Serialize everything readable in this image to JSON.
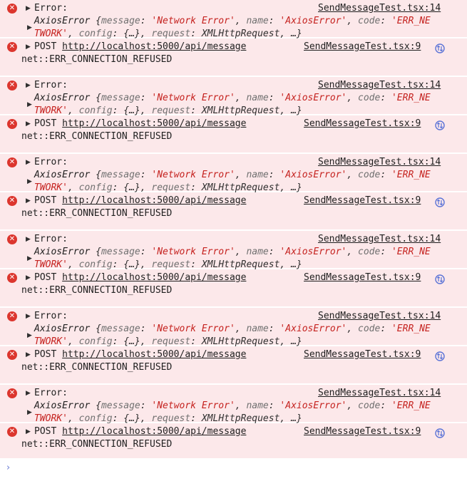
{
  "console": {
    "messages": [
      {
        "kind": "error-object",
        "label": "Error:",
        "source": "SendMessageTest.tsx:14",
        "class_name": "AxiosError",
        "brace_open": "{",
        "k1": "message",
        "v1": "'Network Error'",
        "k2": "name",
        "v2": "'AxiosError'",
        "k3": "code",
        "v3a": "'ERR_NE",
        "v3b": "TWORK'",
        "k4": "config",
        "v4": "{…}",
        "k5": "request",
        "v5": "XMLHttpRequest",
        "tail": ", …}"
      },
      {
        "kind": "network-error",
        "method": "POST",
        "url": "http://localhost:5000/api/message",
        "source": "SendMessageTest.tsx:9",
        "detail": "net::ERR_CONNECTION_REFUSED"
      },
      {
        "kind": "error-object",
        "label": "Error:",
        "source": "SendMessageTest.tsx:14",
        "class_name": "AxiosError",
        "brace_open": "{",
        "k1": "message",
        "v1": "'Network Error'",
        "k2": "name",
        "v2": "'AxiosError'",
        "k3": "code",
        "v3a": "'ERR_NE",
        "v3b": "TWORK'",
        "k4": "config",
        "v4": "{…}",
        "k5": "request",
        "v5": "XMLHttpRequest",
        "tail": ", …}"
      },
      {
        "kind": "network-error",
        "method": "POST",
        "url": "http://localhost:5000/api/message",
        "source": "SendMessageTest.tsx:9",
        "detail": "net::ERR_CONNECTION_REFUSED"
      },
      {
        "kind": "error-object",
        "label": "Error:",
        "source": "SendMessageTest.tsx:14",
        "class_name": "AxiosError",
        "brace_open": "{",
        "k1": "message",
        "v1": "'Network Error'",
        "k2": "name",
        "v2": "'AxiosError'",
        "k3": "code",
        "v3a": "'ERR_NE",
        "v3b": "TWORK'",
        "k4": "config",
        "v4": "{…}",
        "k5": "request",
        "v5": "XMLHttpRequest",
        "tail": ", …}"
      },
      {
        "kind": "network-error",
        "method": "POST",
        "url": "http://localhost:5000/api/message",
        "source": "SendMessageTest.tsx:9",
        "detail": "net::ERR_CONNECTION_REFUSED"
      },
      {
        "kind": "error-object",
        "label": "Error:",
        "source": "SendMessageTest.tsx:14",
        "class_name": "AxiosError",
        "brace_open": "{",
        "k1": "message",
        "v1": "'Network Error'",
        "k2": "name",
        "v2": "'AxiosError'",
        "k3": "code",
        "v3a": "'ERR_NE",
        "v3b": "TWORK'",
        "k4": "config",
        "v4": "{…}",
        "k5": "request",
        "v5": "XMLHttpRequest",
        "tail": ", …}"
      },
      {
        "kind": "network-error",
        "method": "POST",
        "url": "http://localhost:5000/api/message",
        "source": "SendMessageTest.tsx:9",
        "detail": "net::ERR_CONNECTION_REFUSED"
      },
      {
        "kind": "error-object",
        "label": "Error:",
        "source": "SendMessageTest.tsx:14",
        "class_name": "AxiosError",
        "brace_open": "{",
        "k1": "message",
        "v1": "'Network Error'",
        "k2": "name",
        "v2": "'AxiosError'",
        "k3": "code",
        "v3a": "'ERR_NE",
        "v3b": "TWORK'",
        "k4": "config",
        "v4": "{…}",
        "k5": "request",
        "v5": "XMLHttpRequest",
        "tail": ", …}"
      },
      {
        "kind": "network-error",
        "method": "POST",
        "url": "http://localhost:5000/api/message",
        "source": "SendMessageTest.tsx:9",
        "detail": "net::ERR_CONNECTION_REFUSED"
      },
      {
        "kind": "error-object",
        "label": "Error:",
        "source": "SendMessageTest.tsx:14",
        "class_name": "AxiosError",
        "brace_open": "{",
        "k1": "message",
        "v1": "'Network Error'",
        "k2": "name",
        "v2": "'AxiosError'",
        "k3": "code",
        "v3a": "'ERR_NE",
        "v3b": "TWORK'",
        "k4": "config",
        "v4": "{…}",
        "k5": "request",
        "v5": "XMLHttpRequest",
        "tail": ", …}"
      },
      {
        "kind": "network-error",
        "method": "POST",
        "url": "http://localhost:5000/api/message",
        "source": "SendMessageTest.tsx:9",
        "detail": "net::ERR_CONNECTION_REFUSED"
      }
    ],
    "prompt": {
      "chevron": "›"
    }
  },
  "icons": {
    "error": "error-circle-icon",
    "network": "network-request-icon",
    "expand": "expand-triangle-icon"
  },
  "colors": {
    "error_background": "#fce8ea",
    "error_icon": "#dc362e",
    "string_value": "#c5221f",
    "property_key": "#707070",
    "prompt_chevron": "#6a7dd4",
    "network_icon": "#5b73d6"
  }
}
